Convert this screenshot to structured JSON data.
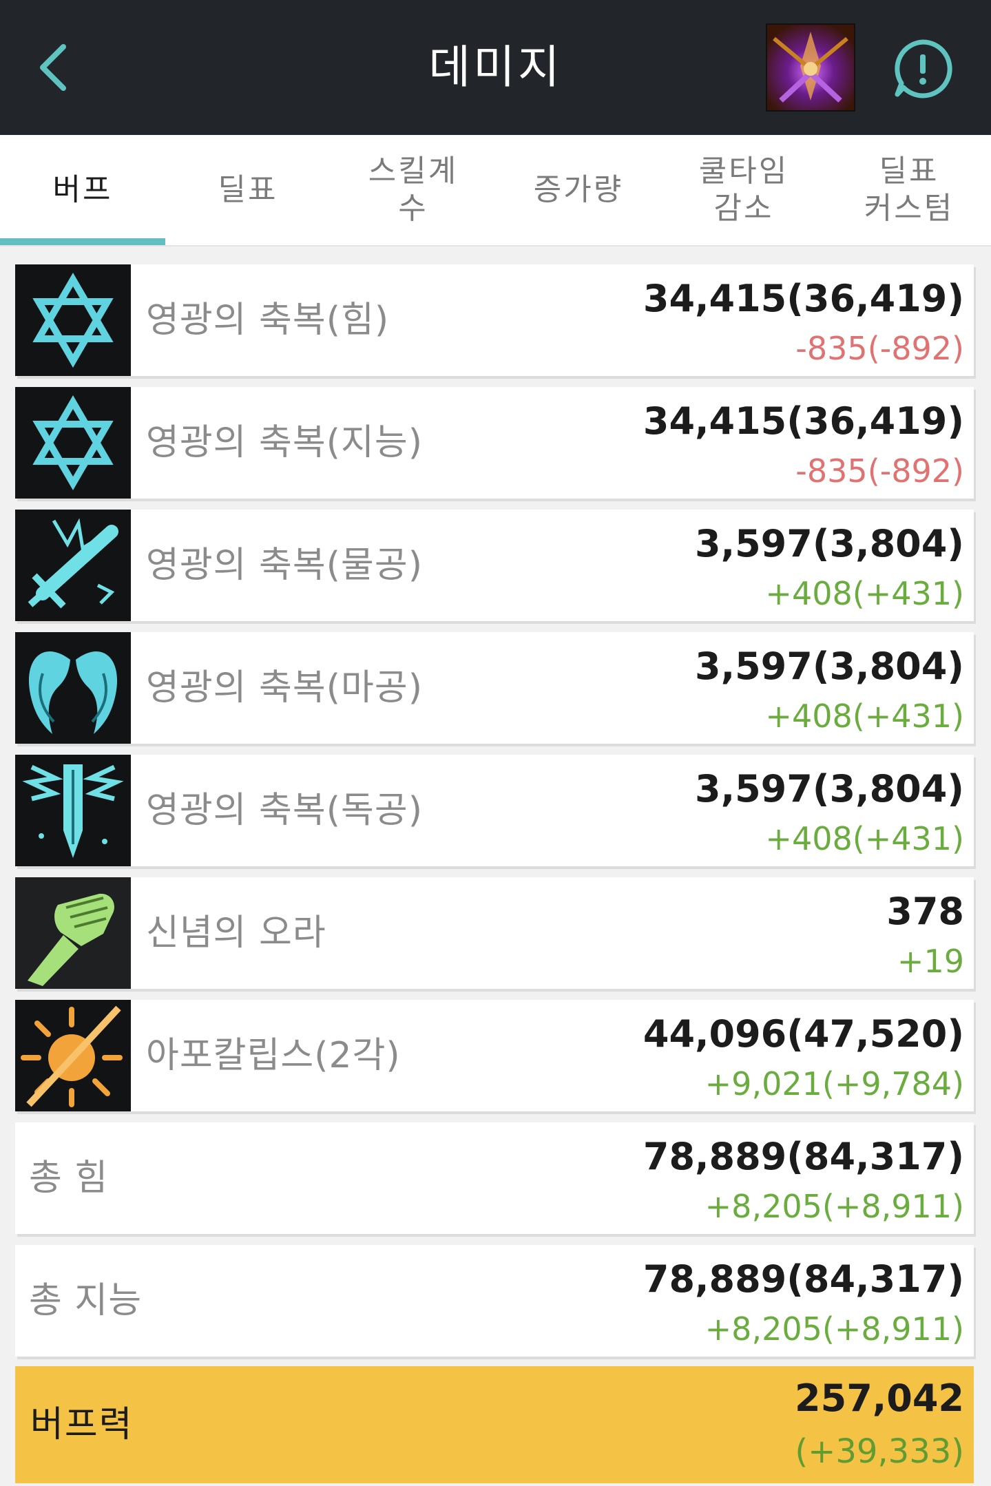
{
  "header": {
    "title": "데미지"
  },
  "tabs": [
    {
      "label": "버프"
    },
    {
      "label": "딜표"
    },
    {
      "label": "스킬계\n수"
    },
    {
      "label": "증가량"
    },
    {
      "label": "쿨타임\n감소"
    },
    {
      "label": "딜표\n커스텀"
    }
  ],
  "active_tab_index": 0,
  "colors": {
    "header_bg": "#22262b",
    "accent": "#62bfbf",
    "negative": "#e07272",
    "positive": "#6aac3e",
    "highlight_row": "#f4c244"
  },
  "rows": [
    {
      "icon": "hexagram-icon",
      "name": "영광의 축복(힘)",
      "value": "34,415(36,419)",
      "delta": "-835(-892)",
      "delta_sign": "neg"
    },
    {
      "icon": "hexagram-icon",
      "name": "영광의 축복(지능)",
      "value": "34,415(36,419)",
      "delta": "-835(-892)",
      "delta_sign": "neg"
    },
    {
      "icon": "sword-icon",
      "name": "영광의 축복(물공)",
      "value": "3,597(3,804)",
      "delta": "+408(+431)",
      "delta_sign": "pos"
    },
    {
      "icon": "wings-icon",
      "name": "영광의 축복(마공)",
      "value": "3,597(3,804)",
      "delta": "+408(+431)",
      "delta_sign": "pos"
    },
    {
      "icon": "blade-down-icon",
      "name": "영광의 축복(독공)",
      "value": "3,597(3,804)",
      "delta": "+408(+431)",
      "delta_sign": "pos"
    },
    {
      "icon": "fist-icon",
      "name": "신념의 오라",
      "value": "378",
      "delta": "+19",
      "delta_sign": "pos"
    },
    {
      "icon": "sunburst-icon",
      "name": "아포칼립스(2각)",
      "value": "44,096(47,520)",
      "delta": "+9,021(+9,784)",
      "delta_sign": "pos"
    }
  ],
  "totals": [
    {
      "name": "총 힘",
      "value": "78,889(84,317)",
      "delta": "+8,205(+8,911)"
    },
    {
      "name": "총 지능",
      "value": "78,889(84,317)",
      "delta": "+8,205(+8,911)"
    }
  ],
  "buff_power": {
    "name": "버프력",
    "value": "257,042",
    "delta": "(+39,333)"
  }
}
